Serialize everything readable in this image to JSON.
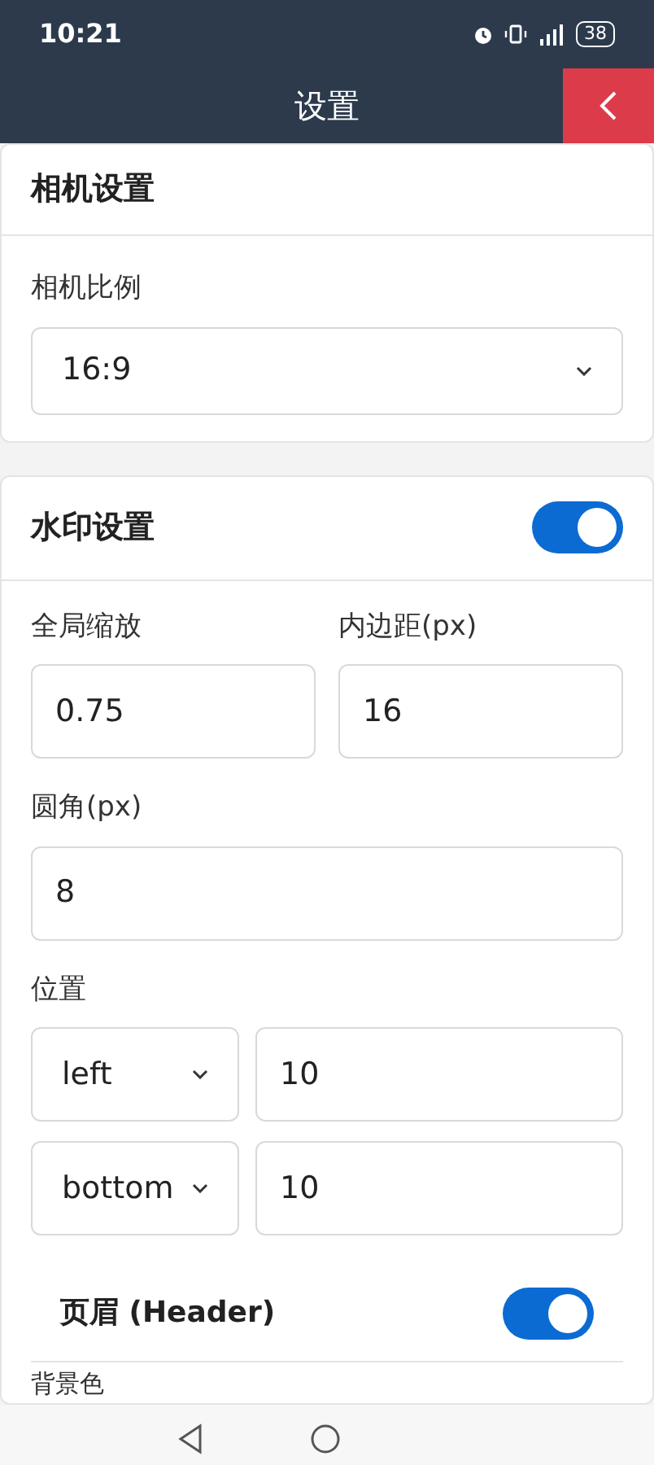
{
  "status_bar": {
    "time": "10:21",
    "battery": "38"
  },
  "header": {
    "title": "设置"
  },
  "camera": {
    "title": "相机设置",
    "fields": [
      {
        "label": "相机比例",
        "kind": "select",
        "value": "16:9"
      }
    ]
  },
  "watermark": {
    "title": "水印设置",
    "on": true,
    "scale": {
      "label": "全局缩放",
      "value": "0.75"
    },
    "padding": {
      "label": "内边距(px)",
      "value": "16"
    },
    "radius": {
      "label": "圆角(px)",
      "value": "8"
    },
    "position": {
      "label": "位置",
      "rows": [
        {
          "select": "left",
          "value": "10"
        },
        {
          "select": "bottom",
          "value": "10"
        }
      ]
    },
    "header_section": {
      "title": "页眉 (Header)",
      "on": true
    },
    "next_label": "背景色"
  }
}
